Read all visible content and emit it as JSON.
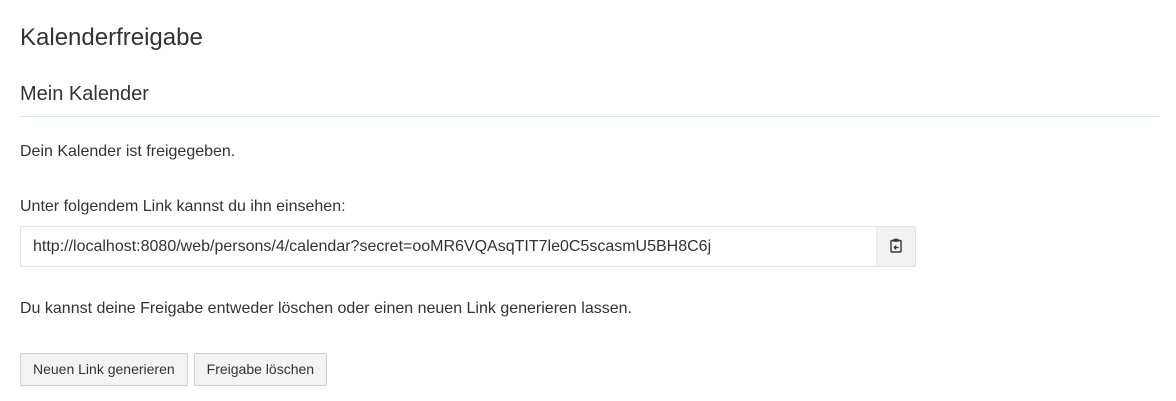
{
  "page": {
    "title": "Kalenderfreigabe"
  },
  "section": {
    "title": "Mein Kalender"
  },
  "status_text": "Dein Kalender ist freigegeben.",
  "link_label": "Unter folgendem Link kannst du ihn einsehen:",
  "link": {
    "value": "http://localhost:8080/web/persons/4/calendar?secret=ooMR6VQAsqTIT7le0C5scasmU5BH8C6j",
    "copy_icon": "clipboard-copy-icon"
  },
  "hint_text": "Du kannst deine Freigabe entweder löschen oder einen neuen Link generieren lassen.",
  "buttons": {
    "generate_label": "Neuen Link generieren",
    "delete_label": "Freigabe löschen"
  },
  "colors": {
    "divider": "#dde6ea",
    "button_bg": "#f3f3f3"
  }
}
